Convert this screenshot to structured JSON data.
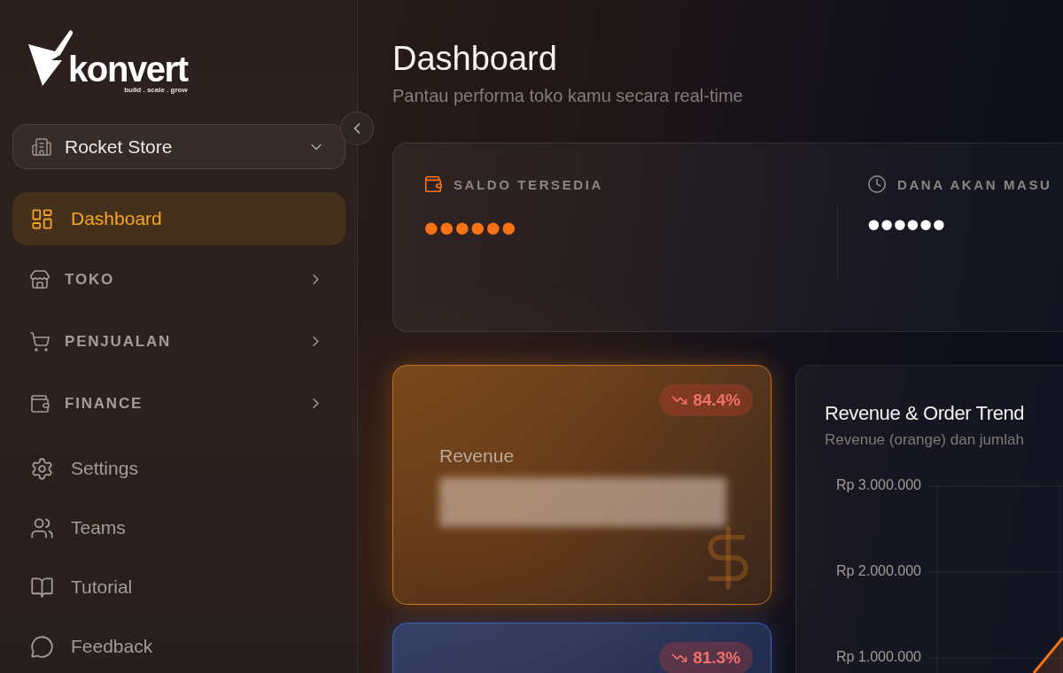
{
  "sidebar": {
    "logo": {
      "wordmark": "konvert",
      "tagline": "build . scale . grow"
    },
    "store_selector": {
      "label": "Rocket Store"
    },
    "items": [
      {
        "label": "Dashboard",
        "kind": "link",
        "selected": true
      },
      {
        "label": "TOKO",
        "kind": "group",
        "selected": false
      },
      {
        "label": "PENJUALAN",
        "kind": "group",
        "selected": false
      },
      {
        "label": "FINANCE",
        "kind": "group",
        "selected": false
      },
      {
        "label": "Settings",
        "kind": "link",
        "selected": false
      },
      {
        "label": "Teams",
        "kind": "link",
        "selected": false
      },
      {
        "label": "Tutorial",
        "kind": "link",
        "selected": false
      },
      {
        "label": "Feedback",
        "kind": "link",
        "selected": false
      }
    ]
  },
  "header": {
    "title": "Dashboard",
    "subtitle": "Pantau performa toko kamu secara real-time"
  },
  "balances": [
    {
      "label": "SALDO TERSEDIA",
      "value": "••••••",
      "highlighted": true
    },
    {
      "label": "DANA AKAN MASU",
      "value": "••••••",
      "highlighted": false
    }
  ],
  "stat_cards": [
    {
      "label": "Revenue",
      "change": "84.4%",
      "decrease": true,
      "value_hidden": true,
      "color": "#c8731f"
    },
    {
      "change": "81.3%",
      "decrease": true,
      "color": "#3d63b8"
    }
  ],
  "chart_card": {
    "title": "Revenue & Order Trend",
    "subtitle": "Revenue (orange) dan jumlah",
    "y_axis_labels": [
      "Rp 3.000.000",
      "Rp 2.000.000",
      "Rp 1.000.000"
    ]
  }
}
